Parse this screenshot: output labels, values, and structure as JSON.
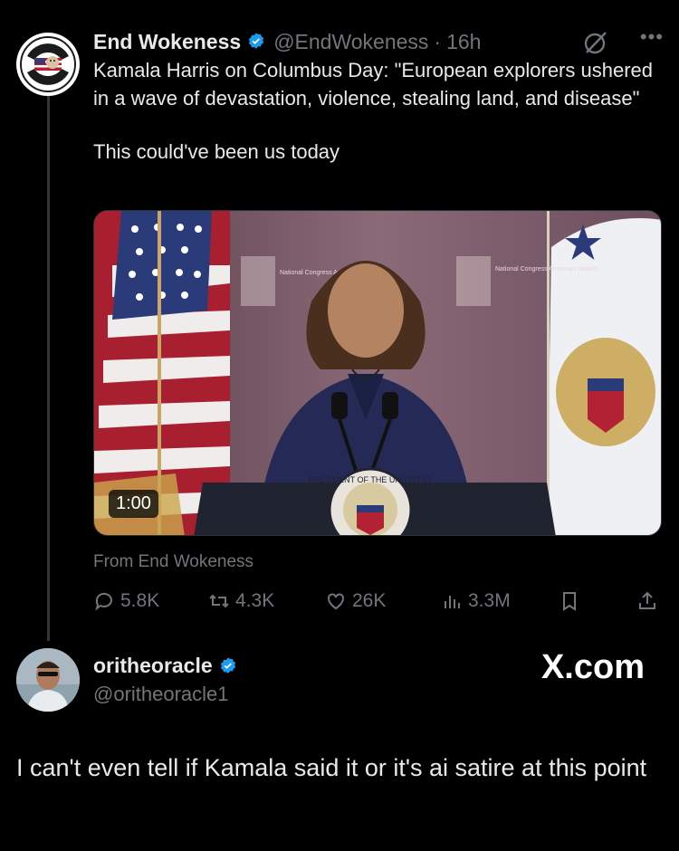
{
  "tweet": {
    "author_name": "End Wokeness",
    "author_handle": "@EndWokeness",
    "time_sep": "·",
    "time": "16h",
    "more_label": "•••",
    "text_line1": "Kamala Harris on Columbus Day: \"European explorers ushered in a wave of devastation, violence, stealing land, and disease\"",
    "text_line2": "This could've been us today",
    "avatar_logo_text_top": "I SUPPORT THE",
    "avatar_logo_text_bottom": "FORMER THINGS",
    "video_duration": "1:00",
    "from_label": "From End Wokeness",
    "podium_seal_text": "PRESIDENT OF THE UNITED ST",
    "backdrop_text_1": "National Congress American Indians",
    "backdrop_text_2": "National Congress American Indians"
  },
  "actions": {
    "replies": "5.8K",
    "reposts": "4.3K",
    "likes": "26K",
    "views": "3.3M"
  },
  "reply": {
    "author_name": "oritheoracle",
    "author_handle": "@oritheoracle1",
    "brand": "X.com",
    "text": "I can't even tell if Kamala said it or it's ai satire at this point"
  },
  "colors": {
    "background": "#000000",
    "text": "#e7e9ea",
    "muted": "#71767b",
    "verified": "#1d9bf0"
  }
}
